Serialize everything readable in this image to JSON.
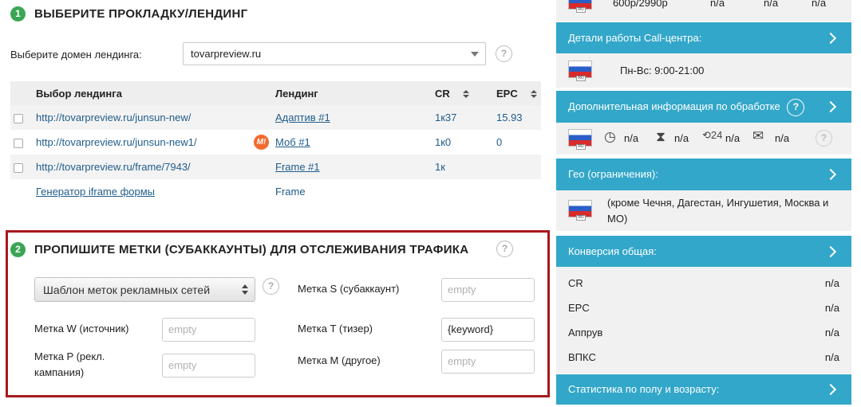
{
  "step1": {
    "number": "1",
    "title": "ВЫБЕРИТЕ ПРОКЛАДКУ/ЛЕНДИНГ",
    "domain_label": "Выберите домен лендинга:",
    "domain_value": "tovarpreview.ru",
    "help": "?",
    "table": {
      "headers": [
        "Выбор лендинга",
        "Лендинг",
        "CR",
        "EPC"
      ],
      "rows": [
        {
          "url": "http://tovarpreview.ru/junsun-new/",
          "landing": "Адаптив #1",
          "cr": "1к37",
          "epc": "15.93",
          "badge": ""
        },
        {
          "url": "http://tovarpreview.ru/junsun-new1/",
          "landing": "Моб #1",
          "cr": "1к0",
          "epc": "0",
          "badge": "M!"
        },
        {
          "url": "http://tovarpreview.ru/frame/7943/",
          "landing": "Frame #1",
          "cr": "1к",
          "epc": "",
          "badge": ""
        }
      ],
      "generator": {
        "label": "Генератор iframe формы",
        "landing": "Frame"
      }
    }
  },
  "step2": {
    "number": "2",
    "title": "ПРОПИШИТЕ МЕТКИ (СУБАККАУНТЫ) ДЛЯ ОТСЛЕЖИВАНИЯ ТРАФИКА",
    "help": "?",
    "template_select": "Шаблон меток рекламных сетей",
    "fields": {
      "w_label": "Метка W (источник)",
      "w_placeholder": "empty",
      "p_label": "Метка P (рекл. кампания)",
      "p_placeholder": "empty",
      "s_label": "Метка S (субаккаунт)",
      "s_placeholder": "empty",
      "t_label": "Метка T (тизер)",
      "t_value": "{keyword}",
      "m_label": "Метка M (другое)",
      "m_placeholder": "empty"
    }
  },
  "right": {
    "top_row": {
      "price": "600р/2990р",
      "a": "n/a",
      "b": "n/a",
      "c": "n/a"
    },
    "callcenter_header": "Детали работы Call-центра:",
    "callcenter_hours": "Пн-Вс: 9:00-21:00",
    "extra_header": "Дополнительная информация по обработке",
    "extra_values": [
      "n/a",
      "n/a",
      "n/a",
      "n/a"
    ],
    "geo_header": "Гео (ограничения):",
    "geo_text": "(кроме Чечня, Дагестан, Ингушетия, Москва и МО)",
    "conv_header": "Конверсия общая:",
    "conv_rows": [
      {
        "k": "CR",
        "v": "n/a"
      },
      {
        "k": "EPC",
        "v": "n/a"
      },
      {
        "k": "Аппрув",
        "v": "n/a"
      },
      {
        "k": "ВПКС",
        "v": "n/a"
      }
    ],
    "stats_header": "Статистика по полу и возрасту:",
    "flag_label": "RU",
    "help": "?"
  },
  "colors": {
    "accent": "#33a7c9",
    "step": "#3aa655",
    "frame": "#a8181d",
    "link": "#1f5c8b",
    "badge": "#f26a2e"
  }
}
